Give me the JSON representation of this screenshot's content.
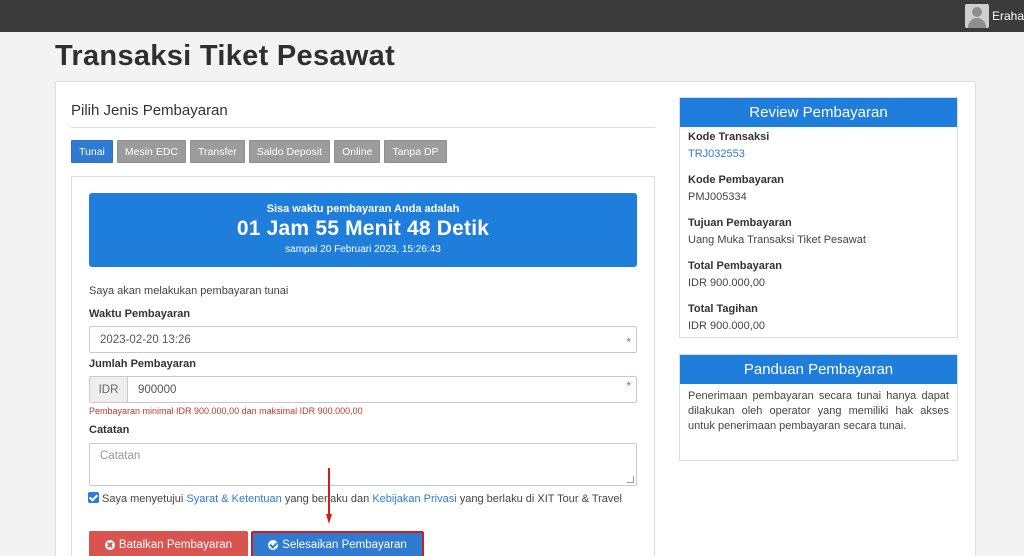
{
  "header": {
    "username": "Eraha"
  },
  "page": {
    "title": "Transaksi Tiket Pesawat"
  },
  "payment": {
    "section_title": "Pilih Jenis Pembayaran",
    "tabs": [
      {
        "label": "Tunai",
        "active": true
      },
      {
        "label": "Mesin EDC",
        "active": false
      },
      {
        "label": "Transfer",
        "active": false
      },
      {
        "label": "Saldo Deposit",
        "active": false
      },
      {
        "label": "Online",
        "active": false
      },
      {
        "label": "Tanpa DP",
        "active": false
      }
    ]
  },
  "timer": {
    "label": "Sisa waktu pembayaran Anda adalah",
    "countdown": "01 Jam 55 Menit 48 Detik",
    "until": "sampai 20 Februari 2023, 15:26:43"
  },
  "form": {
    "intro": "Saya akan melakukan pembayaran tunai",
    "waktu_label": "Waktu Pembayaran",
    "waktu_value": "2023-02-20 13:26",
    "jumlah_label": "Jumlah Pembayaran",
    "currency": "IDR",
    "jumlah_value": "900000",
    "hint": "Pembayaran minimal IDR 900.000,00 dan maksimal IDR 900.000,00",
    "catatan_label": "Catatan",
    "catatan_placeholder": "Catatan",
    "required_mark": "*",
    "agree_prefix": "Saya menyetujui ",
    "agree_link1": "Syarat & Ketentuan",
    "agree_middle": " yang berlaku dan ",
    "agree_link2": "Kebijakan Privasi",
    "agree_suffix": " yang berlaku di XIT Tour & Travel",
    "agree_checked": true,
    "cancel_label": "Batalkan Pembayaran",
    "finish_label": "Selesaikan Pembayaran"
  },
  "review": {
    "title": "Review Pembayaran",
    "items": [
      {
        "label": "Kode Transaksi",
        "value": "TRJ032553"
      },
      {
        "label": "Kode Pembayaran",
        "value": "PMJ005334"
      },
      {
        "label": "Tujuan Pembayaran",
        "value": "Uang Muka Transaksi Tiket Pesawat"
      },
      {
        "label": "Total Pembayaran",
        "value": "IDR 900.000,00"
      },
      {
        "label": "Total Tagihan",
        "value": "IDR 900.000,00"
      }
    ]
  },
  "guide": {
    "title": "Panduan Pembayaran",
    "text": "Penerimaan pembayaran secara tunai hanya dapat dilakukan oleh operator yang memiliki hak akses untuk penerimaan pembayaran secara tunai."
  },
  "colors": {
    "primary": "#2f7bd1",
    "timer_bg": "#1f7edb",
    "danger": "#d9534f",
    "highlight": "#d41c1c",
    "topbar": "#3b3b3b"
  }
}
